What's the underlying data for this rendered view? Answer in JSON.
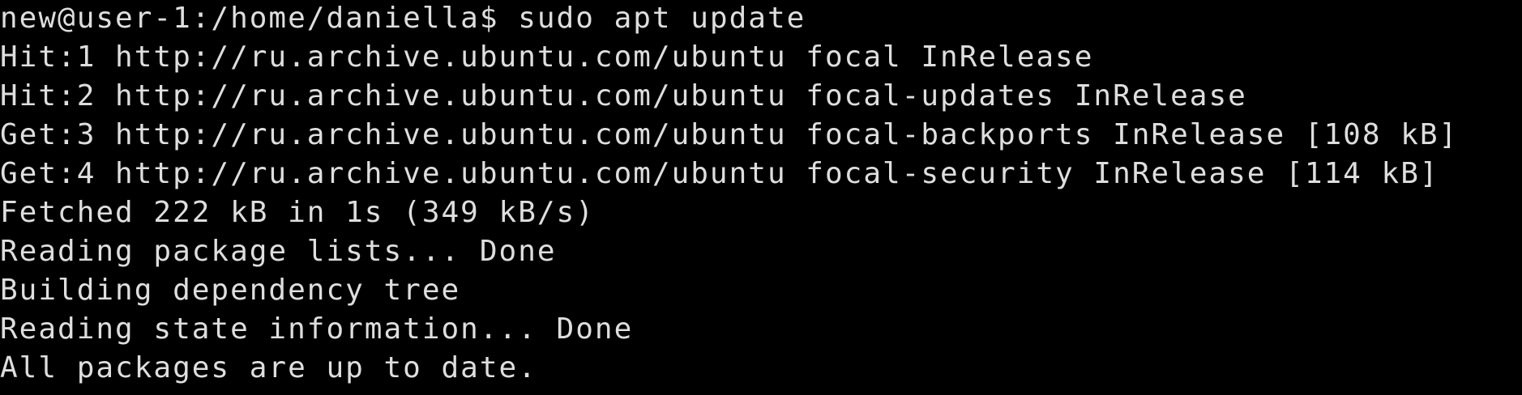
{
  "terminal": {
    "background": "#000000",
    "foreground": "#dedede",
    "lines": [
      "new@user-1:/home/daniella$ sudo apt update",
      "Hit:1 http://ru.archive.ubuntu.com/ubuntu focal InRelease",
      "Hit:2 http://ru.archive.ubuntu.com/ubuntu focal-updates InRelease",
      "Get:3 http://ru.archive.ubuntu.com/ubuntu focal-backports InRelease [108 kB]",
      "Get:4 http://ru.archive.ubuntu.com/ubuntu focal-security InRelease [114 kB]",
      "Fetched 222 kB in 1s (349 kB/s)",
      "Reading package lists... Done",
      "Building dependency tree",
      "Reading state information... Done",
      "All packages are up to date."
    ]
  }
}
